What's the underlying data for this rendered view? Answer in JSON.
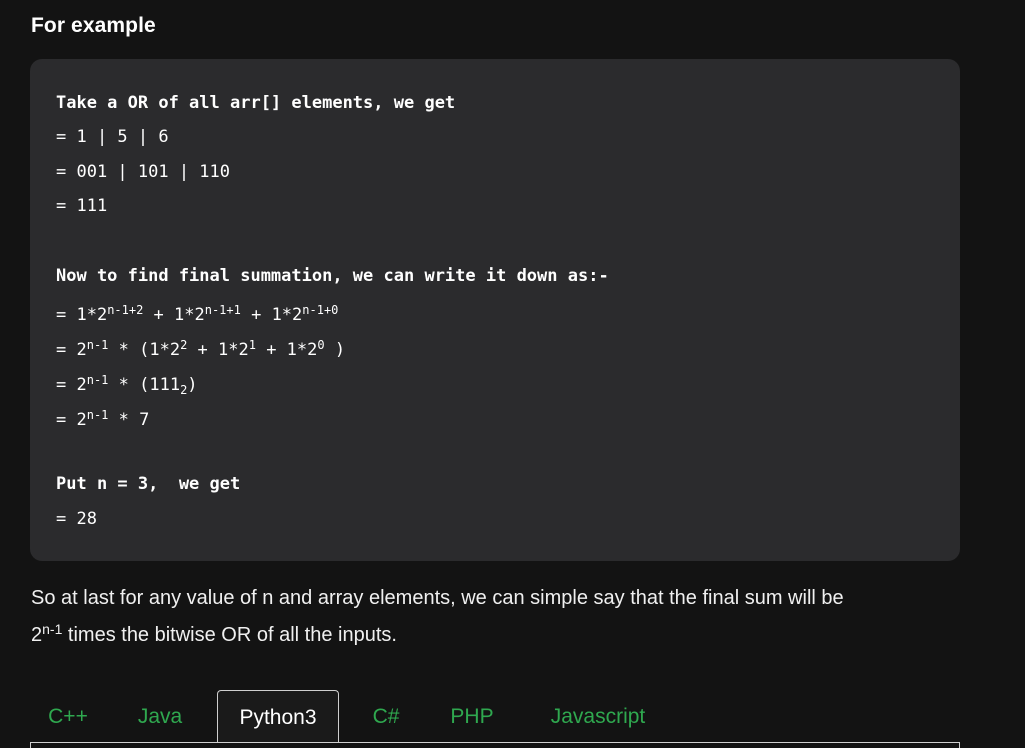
{
  "heading": "For example",
  "code": {
    "line1": "Take a OR of all arr[] elements, we get",
    "line2": "= 1 | 5 | 6",
    "line3": "= 001 | 101 | 110",
    "line4": "= 111",
    "line5": "Now to find final summation, we can write it down as:-",
    "line6": {
      "prefix": "= 1*2",
      "sup1": "n-1+2",
      "mid1": " + 1*2",
      "sup2": "n-1+1",
      "mid2": " + 1*2",
      "sup3": "n-1+0"
    },
    "line7": {
      "prefix": "= 2",
      "sup1": "n-1",
      "mid1": " * (1*2",
      "sup2": "2",
      "mid2": " + 1*2",
      "sup3": "1",
      "mid3": " + 1*2",
      "sup4": "0",
      "end": " )"
    },
    "line8": {
      "prefix": "= 2",
      "sup1": "n-1",
      "mid1": " * (111",
      "sub1": "2",
      "end": ")"
    },
    "line9": {
      "prefix": "= 2",
      "sup1": "n-1",
      "end": " * 7"
    },
    "line10": "Put n = 3,  we get",
    "line11": "= 28"
  },
  "paragraph": {
    "text1": "So at last for any value of n and array elements, we can simple say that the final sum will be",
    "pre2": "2",
    "sup2": "n-1",
    "text2": " times the bitwise OR of all the inputs."
  },
  "tabs": [
    "C++",
    "Java",
    "Python3",
    "C#",
    "PHP",
    "Javascript"
  ],
  "active_tab": "Python3",
  "colors": {
    "background": "#131313",
    "code_background": "#2b2b2d",
    "tab_link": "#2fa84f",
    "text": "#ffffff"
  }
}
